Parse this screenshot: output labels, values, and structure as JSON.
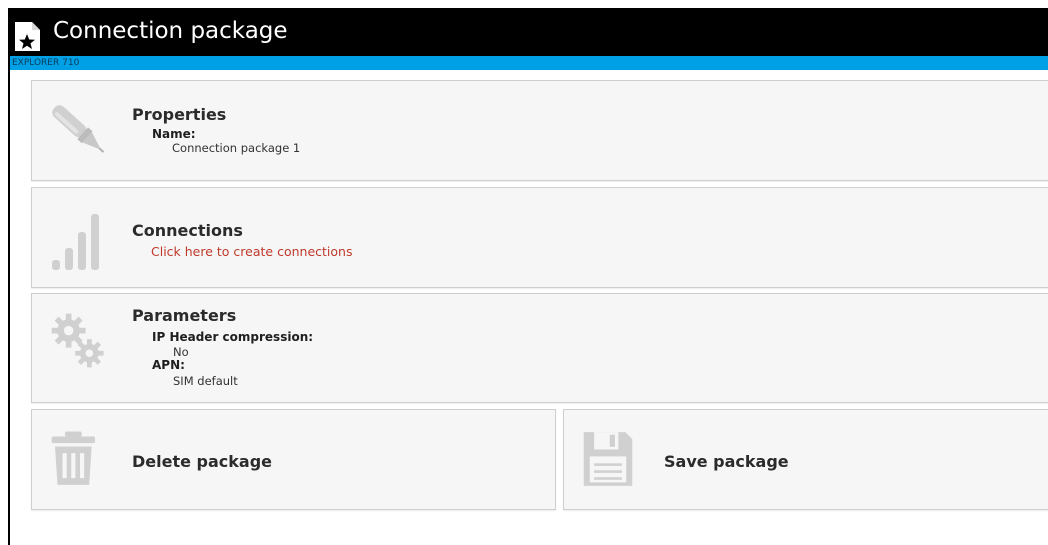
{
  "window": {
    "title": "Connection package",
    "device": "EXPLORER 710"
  },
  "colors": {
    "title_bar": "#000000",
    "device_strip": "#00a0e6",
    "card_background": "#f6f6f6",
    "link_red": "#c0392b",
    "icon_gray": "#cfcfcf"
  },
  "properties": {
    "title": "Properties",
    "name_label": "Name:",
    "name_value": "Connection package 1",
    "icon": "pen-icon"
  },
  "connections": {
    "title": "Connections",
    "link": "Click here to create connections",
    "icon": "signal-bars-icon"
  },
  "parameters": {
    "title": "Parameters",
    "header_compression_label": "IP Header compression:",
    "header_compression_value": "No",
    "apn_label": "APN:",
    "apn_value": "SIM default",
    "icon": "gears-icon"
  },
  "actions": {
    "delete_label": "Delete package",
    "delete_icon": "trash-icon",
    "save_label": "Save package",
    "save_icon": "floppy-disk-icon"
  }
}
